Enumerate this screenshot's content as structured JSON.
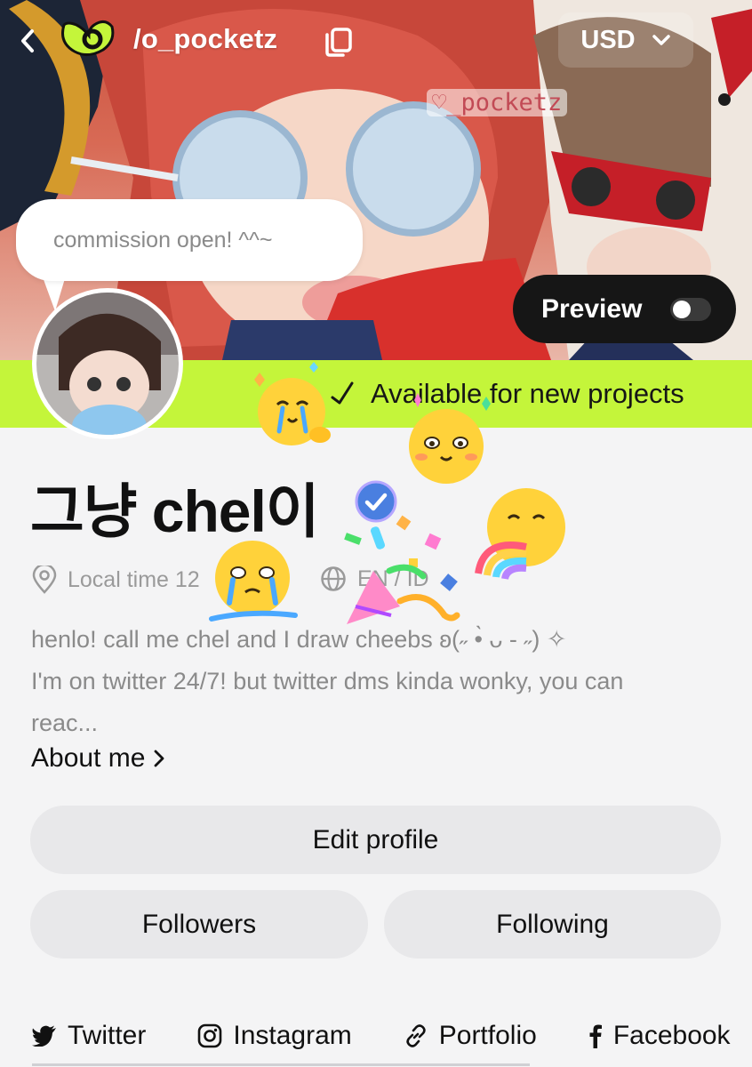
{
  "header": {
    "handle": "/o_pocketz",
    "currency": "USD",
    "watermark": "♡_pocketz"
  },
  "banner": {
    "speech_bubble": "commission open! ^^~",
    "preview_label": "Preview",
    "preview_enabled": false
  },
  "availability": {
    "text": "Available for new projects"
  },
  "profile": {
    "display_name": "그냥 chel이",
    "verified": true,
    "local_time": "Local time 12",
    "languages": "EN / ID",
    "bio_lines": [
      "henlo! call me chel and I draw cheebs ʚ(˶ •̀ ᴗ - ˶) ✧",
      "I'm on twitter 24/7! but twitter dms kinda wonky, you can",
      "reac..."
    ],
    "about_label": "About me"
  },
  "buttons": {
    "edit_profile": "Edit profile",
    "followers": "Followers",
    "following": "Following"
  },
  "socials": [
    {
      "label": "Twitter",
      "icon": "twitter-bird-icon"
    },
    {
      "label": "Instagram",
      "icon": "instagram-icon"
    },
    {
      "label": "Portfolio",
      "icon": "link-icon"
    },
    {
      "label": "Facebook",
      "icon": "facebook-icon"
    }
  ],
  "colors": {
    "accent_green": "#c4f53a",
    "verified_blue": "#4a7fe0",
    "button_gray": "#e8e8ea",
    "preview_black": "#161616"
  }
}
